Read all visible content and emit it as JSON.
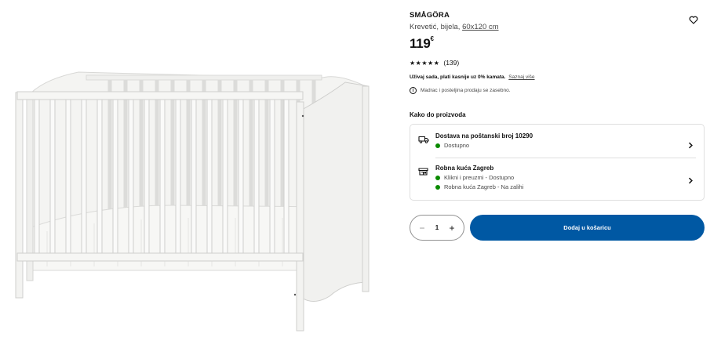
{
  "product": {
    "name": "SMÅGÖRA",
    "description": "Krevetić, bijela,",
    "size": "60x120 cm",
    "price": "119",
    "currency": "€",
    "rating_count": "(139)",
    "rating_stars": "★★★★★",
    "rating_value": 4.5
  },
  "klarna": {
    "text": "Uživaj sada, plati kasnije uz 0% kamata.",
    "link": "Saznaj više"
  },
  "notice": {
    "icon": "i",
    "text": "Madrac i posteljina prodaju se zasebno."
  },
  "delivery": {
    "heading": "Kako do proizvoda",
    "shipping": {
      "title": "Dostava na poštanski broj 10290",
      "status": "Dostupno"
    },
    "store": {
      "title": "Robna kuća Zagreb",
      "status1": "Klikni i preuzmi - Dostupno",
      "status2": "Robna kuća Zagreb - Na zalihi"
    }
  },
  "cart": {
    "quantity": "1",
    "minus": "−",
    "plus": "+",
    "add_label": "Dodaj u košaricu"
  },
  "colors": {
    "primary_button": "#0058a3",
    "available_dot": "#0a8a00"
  }
}
